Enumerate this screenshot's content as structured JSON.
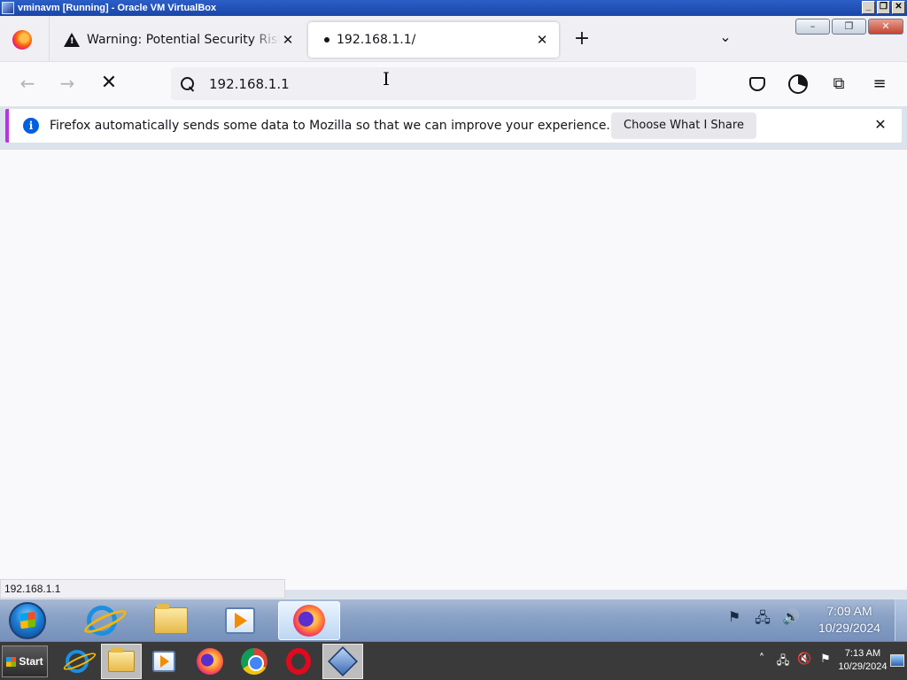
{
  "host_window": {
    "title": "vminavm [Running] - Oracle VM VirtualBox",
    "minimize": "_",
    "restore": "❐",
    "close": "✕"
  },
  "browser": {
    "tabs": [
      {
        "title": "Warning: Potential Security Risk",
        "icon": "warning-icon",
        "active": false
      },
      {
        "title": "192.168.1.1/",
        "icon": "loading-dot",
        "active": true
      }
    ],
    "new_tab": "+",
    "tab_list": "⌄",
    "tab_close": "✕",
    "nav": {
      "back": "←",
      "forward": "→",
      "stop": "✕"
    },
    "url": "192.168.1.1",
    "toolbar_icons": [
      "pocket-icon",
      "account-icon",
      "extensions-icon",
      "menu-icon"
    ],
    "extensions_glyph": "⧉",
    "menu_glyph": "≡",
    "notification": {
      "text": "Firefox automatically sends some data to Mozilla so that we can improve your experience.",
      "button": "Choose What I Share",
      "close": "✕",
      "info_glyph": "i"
    },
    "status_url": "192.168.1.1"
  },
  "guest_taskbar": {
    "pinned": [
      "internet-explorer-icon",
      "file-explorer-icon",
      "media-player-icon",
      "firefox-icon"
    ],
    "active_app": "firefox-icon",
    "tray_glyphs": [
      "⚑",
      "🖧",
      "🔊"
    ],
    "time": "7:09 AM",
    "date": "10/29/2024"
  },
  "host_taskbar": {
    "start_label": "Start",
    "apps": [
      "internet-explorer-icon",
      "file-explorer-icon",
      "media-player-icon",
      "firefox-icon",
      "chrome-icon",
      "opera-icon",
      "virtualbox-icon"
    ],
    "active_app": "file-explorer-icon",
    "tray_glyphs": [
      "˄",
      "🖧",
      "🔇",
      "⚑"
    ],
    "time": "7:13 AM",
    "date": "10/29/2024"
  },
  "colors": {
    "notification_accent": "#b833e1",
    "info_blue": "#0060df",
    "titlebar_blue": "#1a46a8"
  }
}
